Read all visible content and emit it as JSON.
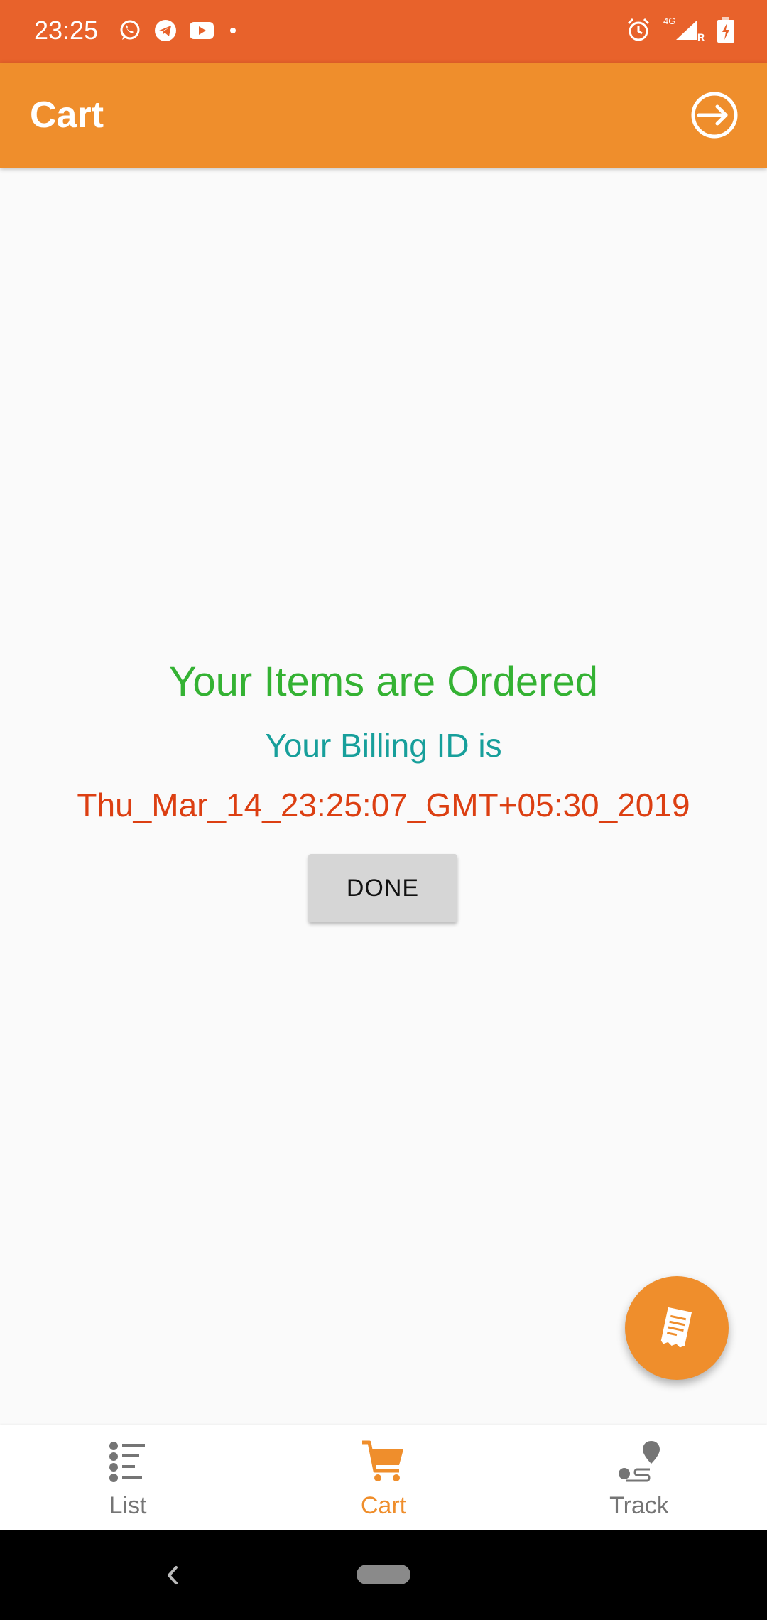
{
  "status_bar": {
    "time": "23:25",
    "left_icons": [
      "whatsapp-icon",
      "telegram-icon",
      "youtube-icon",
      "dot-icon"
    ],
    "right_icons": [
      "alarm-icon",
      "signal-4g-icon",
      "battery-charging-icon"
    ],
    "network_label": "4G",
    "roaming_label": "R"
  },
  "app_bar": {
    "title": "Cart",
    "action_icon": "logout-icon"
  },
  "main": {
    "ordered_title": "Your Items are Ordered",
    "billing_label": "Your Billing ID is",
    "billing_id": "Thu_Mar_14_23:25:07_GMT+05:30_2019",
    "done_label": "DONE"
  },
  "fab": {
    "icon": "receipt-icon"
  },
  "bottom_nav": {
    "items": [
      {
        "label": "List",
        "icon": "list-icon",
        "active": false
      },
      {
        "label": "Cart",
        "icon": "cart-icon",
        "active": true
      },
      {
        "label": "Track",
        "icon": "track-icon",
        "active": false
      }
    ]
  },
  "colors": {
    "status_bar": "#E8622B",
    "app_bar": "#EF8E2C",
    "ordered_text": "#34B233",
    "billing_label_text": "#179F9B",
    "billing_id_text": "#DC3F12",
    "nav_active": "#EF8E2C",
    "nav_inactive": "#757575"
  }
}
